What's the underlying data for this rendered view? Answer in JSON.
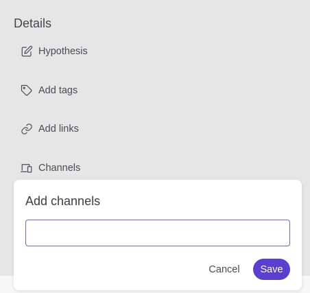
{
  "details": {
    "title": "Details",
    "items": [
      {
        "label": "Hypothesis",
        "icon": "edit-icon"
      },
      {
        "label": "Add tags",
        "icon": "tag-icon"
      },
      {
        "label": "Add links",
        "icon": "link-icon"
      },
      {
        "label": "Channels",
        "icon": "devices-icon"
      }
    ]
  },
  "dialog": {
    "title": "Add channels",
    "input_value": "",
    "input_placeholder": "",
    "cancel_label": "Cancel",
    "save_label": "Save"
  },
  "colors": {
    "accent": "#5a3fcf",
    "input_border": "#6f66c7",
    "panel_background": "#e6e6e6",
    "dialog_background": "#ffffff"
  }
}
